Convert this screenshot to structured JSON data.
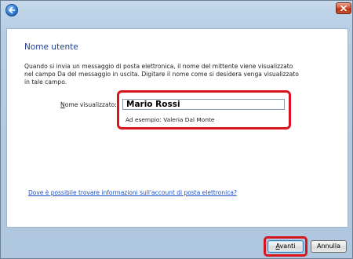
{
  "window": {
    "back_icon": "back-arrow-icon",
    "close_icon": "close-icon"
  },
  "page": {
    "title": "Nome utente",
    "intro_lines": [
      "Quando si invia un messaggio di posta elettronica, il nome del mittente viene visualizzato",
      "nel campo Da del messaggio in uscita. Digitare il nome come si desidera venga visualizzato",
      "in tale campo."
    ],
    "display_name": {
      "label_accesskey": "N",
      "label_rest": "ome visualizzato:",
      "value": "Mario Rossi",
      "example": "Ad esempio: Valeria Dal Monte"
    },
    "help_link": "Dove è possibile trovare informazioni sull'account di posta elettronica?"
  },
  "buttons": {
    "next_accesskey": "A",
    "next_rest": "vanti",
    "cancel": "Annulla"
  },
  "colors": {
    "highlight": "#d8141e",
    "title": "#1f3f8f",
    "link": "#1a4fbf"
  }
}
